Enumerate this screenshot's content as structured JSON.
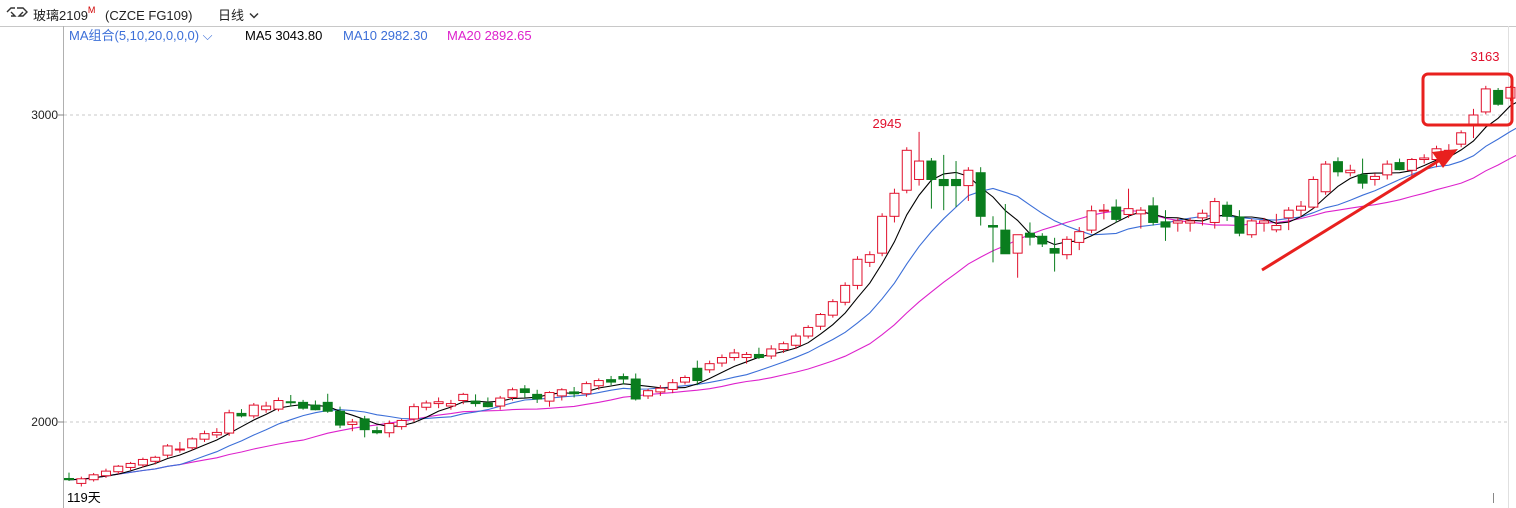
{
  "header": {
    "instrument": "玻璃2109",
    "flag": "M",
    "exchange_code": "(CZCE FG109)",
    "period": "日线"
  },
  "legend": {
    "combo": "MA组合(5,10,20,0,0,0)",
    "ma5": "MA5 3043.80",
    "ma10": "MA10 2982.30",
    "ma20": "MA20 2892.65"
  },
  "colors": {
    "up": "#e0102c",
    "down": "#0a7d1e",
    "ma5": "#000000",
    "ma10": "#3c6fd8",
    "ma20": "#dd22cc",
    "grid": "#c8c8c8",
    "highlight": "#e8201e"
  },
  "chart_data": {
    "type": "candlestick",
    "title": "玻璃2109",
    "y_ticks": [
      2000,
      3000
    ],
    "ylim": [
      1780,
      3320
    ],
    "annotations": {
      "max_label": "3163",
      "local_high_label": "2945",
      "footer": "119天"
    },
    "candles": [
      [
        1816,
        1835,
        1808,
        1812
      ],
      [
        1800,
        1822,
        1790,
        1815
      ],
      [
        1812,
        1834,
        1806,
        1828
      ],
      [
        1825,
        1848,
        1818,
        1840
      ],
      [
        1838,
        1860,
        1830,
        1856
      ],
      [
        1852,
        1870,
        1843,
        1865
      ],
      [
        1860,
        1884,
        1852,
        1878
      ],
      [
        1872,
        1890,
        1862,
        1885
      ],
      [
        1892,
        1928,
        1884,
        1922
      ],
      [
        1910,
        1935,
        1900,
        1912
      ],
      [
        1916,
        1950,
        1908,
        1945
      ],
      [
        1944,
        1972,
        1935,
        1962
      ],
      [
        1958,
        1980,
        1948,
        1966
      ],
      [
        1964,
        2040,
        1955,
        2030
      ],
      [
        2028,
        2042,
        2015,
        2020
      ],
      [
        2020,
        2062,
        2012,
        2055
      ],
      [
        2040,
        2066,
        2030,
        2052
      ],
      [
        2042,
        2080,
        2035,
        2070
      ],
      [
        2066,
        2088,
        2050,
        2064
      ],
      [
        2064,
        2072,
        2040,
        2045
      ],
      [
        2055,
        2070,
        2038,
        2040
      ],
      [
        2064,
        2092,
        2030,
        2035
      ],
      [
        2035,
        2050,
        1980,
        1990
      ],
      [
        1992,
        2010,
        1970,
        2000
      ],
      [
        2010,
        2020,
        1950,
        1975
      ],
      [
        1972,
        1985,
        1960,
        1965
      ],
      [
        1965,
        2005,
        1950,
        1995
      ],
      [
        1985,
        2010,
        1975,
        2005
      ],
      [
        2010,
        2060,
        2000,
        2050
      ],
      [
        2048,
        2070,
        2038,
        2062
      ],
      [
        2060,
        2080,
        2045,
        2066
      ],
      [
        2052,
        2072,
        2040,
        2060
      ],
      [
        2070,
        2095,
        2058,
        2090
      ],
      [
        2068,
        2090,
        2050,
        2060
      ],
      [
        2062,
        2080,
        2048,
        2050
      ],
      [
        2052,
        2085,
        2040,
        2078
      ],
      [
        2080,
        2112,
        2070,
        2105
      ],
      [
        2108,
        2120,
        2080,
        2096
      ],
      [
        2090,
        2105,
        2062,
        2075
      ],
      [
        2068,
        2100,
        2050,
        2096
      ],
      [
        2085,
        2110,
        2070,
        2105
      ],
      [
        2098,
        2114,
        2080,
        2092
      ],
      [
        2092,
        2132,
        2082,
        2125
      ],
      [
        2118,
        2142,
        2105,
        2135
      ],
      [
        2138,
        2150,
        2120,
        2130
      ],
      [
        2148,
        2158,
        2122,
        2140
      ],
      [
        2140,
        2158,
        2070,
        2075
      ],
      [
        2085,
        2108,
        2075,
        2102
      ],
      [
        2098,
        2120,
        2085,
        2110
      ],
      [
        2106,
        2140,
        2094,
        2128
      ],
      [
        2130,
        2152,
        2122,
        2145
      ],
      [
        2175,
        2200,
        2120,
        2135
      ],
      [
        2170,
        2200,
        2160,
        2190
      ],
      [
        2192,
        2220,
        2180,
        2210
      ],
      [
        2210,
        2238,
        2200,
        2225
      ],
      [
        2210,
        2228,
        2190,
        2220
      ],
      [
        2220,
        2242,
        2205,
        2210
      ],
      [
        2215,
        2250,
        2205,
        2238
      ],
      [
        2236,
        2262,
        2225,
        2255
      ],
      [
        2250,
        2288,
        2238,
        2280
      ],
      [
        2280,
        2315,
        2272,
        2308
      ],
      [
        2312,
        2355,
        2300,
        2350
      ],
      [
        2348,
        2400,
        2340,
        2392
      ],
      [
        2390,
        2455,
        2380,
        2445
      ],
      [
        2445,
        2540,
        2432,
        2530
      ],
      [
        2520,
        2556,
        2505,
        2545
      ],
      [
        2550,
        2680,
        2540,
        2670
      ],
      [
        2670,
        2760,
        2650,
        2745
      ],
      [
        2755,
        2895,
        2745,
        2885
      ],
      [
        2790,
        2945,
        2770,
        2850
      ],
      [
        2850,
        2860,
        2695,
        2790
      ],
      [
        2790,
        2870,
        2690,
        2770
      ],
      [
        2790,
        2850,
        2700,
        2770
      ],
      [
        2770,
        2830,
        2720,
        2820
      ],
      [
        2812,
        2830,
        2640,
        2670
      ],
      [
        2640,
        2670,
        2520,
        2635
      ],
      [
        2625,
        2710,
        2570,
        2548
      ],
      [
        2550,
        2590,
        2470,
        2610
      ],
      [
        2615,
        2650,
        2575,
        2602
      ],
      [
        2605,
        2615,
        2570,
        2580
      ],
      [
        2565,
        2600,
        2490,
        2550
      ],
      [
        2545,
        2605,
        2530,
        2595
      ],
      [
        2585,
        2635,
        2560,
        2620
      ],
      [
        2625,
        2705,
        2615,
        2688
      ],
      [
        2690,
        2710,
        2660,
        2690
      ],
      [
        2700,
        2725,
        2650,
        2660
      ],
      [
        2676,
        2760,
        2665,
        2695
      ],
      [
        2678,
        2700,
        2630,
        2690
      ],
      [
        2704,
        2732,
        2640,
        2650
      ],
      [
        2652,
        2690,
        2590,
        2635
      ],
      [
        2648,
        2665,
        2620,
        2655
      ],
      [
        2648,
        2665,
        2620,
        2655
      ],
      [
        2665,
        2692,
        2640,
        2680
      ],
      [
        2650,
        2730,
        2630,
        2718
      ],
      [
        2706,
        2718,
        2655,
        2670
      ],
      [
        2668,
        2690,
        2605,
        2615
      ],
      [
        2610,
        2662,
        2600,
        2655
      ],
      [
        2648,
        2665,
        2620,
        2655
      ],
      [
        2626,
        2678,
        2618,
        2640
      ],
      [
        2665,
        2700,
        2625,
        2690
      ],
      [
        2690,
        2720,
        2670,
        2703
      ],
      [
        2700,
        2800,
        2695,
        2790
      ],
      [
        2750,
        2850,
        2740,
        2840
      ],
      [
        2848,
        2862,
        2800,
        2815
      ],
      [
        2812,
        2838,
        2800,
        2820
      ],
      [
        2805,
        2858,
        2760,
        2778
      ],
      [
        2790,
        2810,
        2770,
        2800
      ],
      [
        2805,
        2852,
        2790,
        2840
      ],
      [
        2845,
        2858,
        2820,
        2822
      ],
      [
        2820,
        2860,
        2800,
        2855
      ],
      [
        2855,
        2872,
        2842,
        2860
      ],
      [
        2855,
        2900,
        2830,
        2890
      ],
      [
        2885,
        2905,
        2860,
        2885
      ],
      [
        2905,
        2950,
        2895,
        2942
      ],
      [
        2965,
        3020,
        2925,
        3000
      ],
      [
        3010,
        3095,
        3002,
        3085
      ],
      [
        3080,
        3088,
        3030,
        3035
      ],
      [
        3055,
        3095,
        3045,
        3090
      ],
      [
        3095,
        3163,
        3050,
        3050
      ],
      [
        3044,
        3052,
        3035,
        3043
      ]
    ]
  }
}
